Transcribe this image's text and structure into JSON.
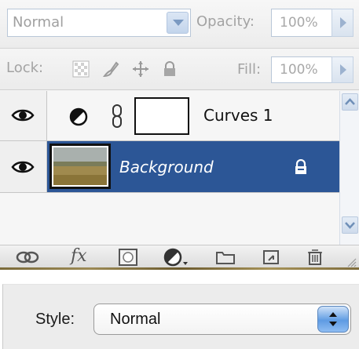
{
  "panel": {
    "blend_mode": "Normal",
    "opacity_label": "Opacity:",
    "opacity_value": "100%",
    "lock_label": "Lock:",
    "fill_label": "Fill:",
    "fill_value": "100%"
  },
  "layers": [
    {
      "name": "Curves 1",
      "visible": true,
      "type": "adjustment",
      "selected": false
    },
    {
      "name": "Background",
      "visible": true,
      "type": "image",
      "locked": true,
      "selected": true
    }
  ],
  "toolbar": {
    "icons": [
      "link-icon",
      "fx-icon",
      "mask-icon",
      "adjustment-icon",
      "folder-icon",
      "new-layer-icon",
      "trash-icon"
    ],
    "fx_label": "fx"
  },
  "style_dialog": {
    "label": "Style:",
    "value": "Normal"
  },
  "colors": {
    "selected_row": "#2c5696",
    "accent": "#b9c7d8"
  }
}
